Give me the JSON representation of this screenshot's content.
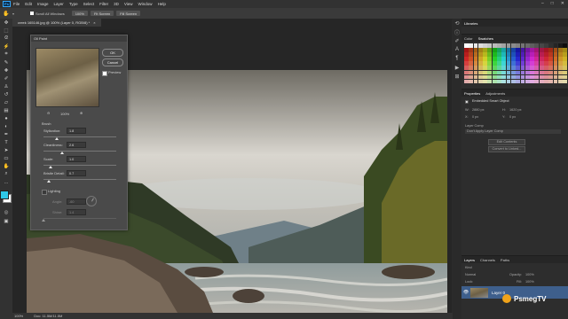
{
  "menubar": {
    "app_icon": "Ps",
    "items": [
      "File",
      "Edit",
      "Image",
      "Layer",
      "Type",
      "Select",
      "Filter",
      "3D",
      "View",
      "Window",
      "Help"
    ],
    "window_controls": [
      "–",
      "□",
      "✕"
    ]
  },
  "optionsbar": {
    "scroll_all": "Scroll All Windows",
    "zoom_value": "100%",
    "fit_screen": "Fit Screen",
    "fill_screen": "Fill Screen"
  },
  "document_tab": {
    "label": "creek 165146.jpg @ 100% (Layer 0, RGB/8) *",
    "close": "×"
  },
  "tools": [
    "move-icon",
    "marquee-icon",
    "lasso-icon",
    "magic-wand-icon",
    "crop-icon",
    "eyedropper-icon",
    "healing-icon",
    "brush-icon",
    "stamp-icon",
    "history-brush-icon",
    "eraser-icon",
    "gradient-icon",
    "blur-icon",
    "dodge-icon",
    "pen-icon",
    "type-icon",
    "path-select-icon",
    "shape-icon",
    "hand-icon",
    "zoom-icon",
    "more-icon"
  ],
  "colors": {
    "foreground": "#2fc8e8",
    "background": "#ffffff",
    "accent": "#31a8ff",
    "selected_layer": "#3e5f8c"
  },
  "dialog": {
    "title": "Oil Paint",
    "ok": "OK",
    "cancel": "Cancel",
    "preview_label": "Preview",
    "preview_checked": true,
    "zoom": "100%",
    "zoom_out": "⊖",
    "zoom_in": "⊕",
    "brush_header": "Brush",
    "params": [
      {
        "label": "Stylization:",
        "value": "1.8",
        "level": 0.18
      },
      {
        "label": "Cleanliness:",
        "value": "2.6",
        "level": 0.26
      },
      {
        "label": "Scale:",
        "value": "1.0",
        "level": 0.1
      },
      {
        "label": "Bristle Detail:",
        "value": "0.7",
        "level": 0.07
      }
    ],
    "lighting_label": "Lighting",
    "lighting_checked": false,
    "angle_label": "Angle:",
    "angle_value": "-60",
    "shine_label": "Shine:",
    "shine_value": "1.4",
    "shine_level": 0.0
  },
  "statusbar": {
    "zoom": "100%",
    "doc": "Doc: 11.5M/11.5M"
  },
  "rightpanel": {
    "libraries_tab": "Libraries",
    "color_tab": "Color",
    "swatches_tab": "Swatches",
    "properties_tab": "Properties",
    "adjustments_tab": "Adjustments",
    "smart_object": "Embedded Smart Object",
    "w_label": "W:",
    "w_value": "2880 px",
    "h_label": "H:",
    "h_value": "1620 px",
    "x_label": "X:",
    "x_value": "0 px",
    "y_label": "Y:",
    "y_value": "0 px",
    "layer_comp": "Layer Comp",
    "dont_apply": "Don't Apply Layer Comp",
    "edit_contents": "Edit Contents",
    "convert_linked": "Convert to Linked...",
    "layers_tab": "Layers",
    "channels_tab": "Channels",
    "paths_tab": "Paths",
    "kind_label": "Kind",
    "blend_mode": "Normal",
    "opacity_label": "Opacity:",
    "opacity_value": "100%",
    "lock_label": "Lock:",
    "fill_label": "Fill:",
    "fill_value": "100%",
    "layer_name": "Layer 0"
  },
  "watermark": "PsmegTV"
}
